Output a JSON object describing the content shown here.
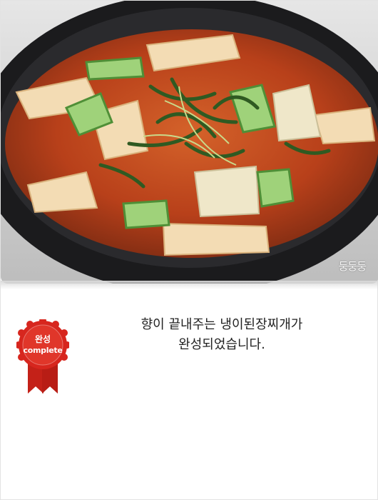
{
  "photo": {
    "alt": "냉이된장찌개",
    "watermark": "둥둥둥"
  },
  "badge": {
    "title": "완성",
    "subtitle": "complete",
    "color": "#d7261e"
  },
  "message": {
    "line1": "향이 끝내주는 냉이된장찌개가",
    "line2": "완성되었습니다."
  }
}
